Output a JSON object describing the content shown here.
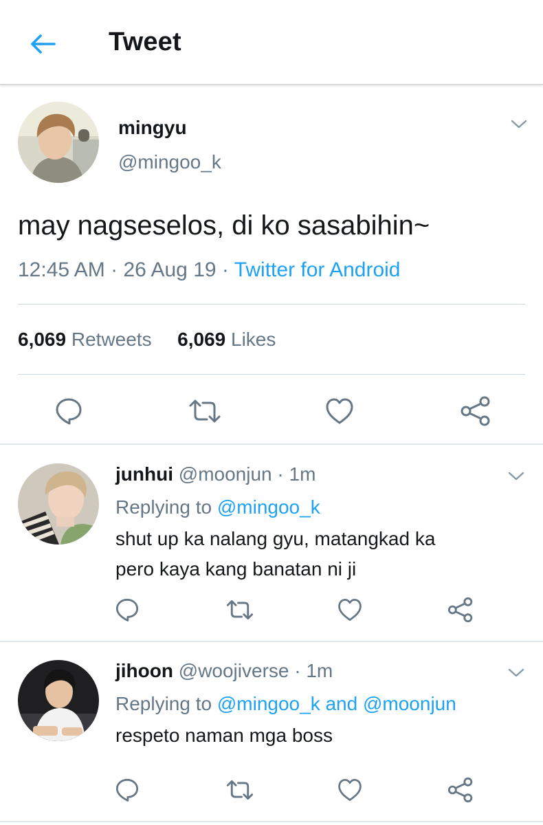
{
  "header": {
    "title": "Tweet"
  },
  "main_tweet": {
    "name": "mingyu",
    "handle": "@mingoo_k",
    "text": "may nagseselos, di ko sasabihin~",
    "time": "12:45 AM",
    "date": "26 Aug 19",
    "source": "Twitter for Android",
    "retweets_count": "6,069",
    "retweets_label": "Retweets",
    "likes_count": "6,069",
    "likes_label": "Likes"
  },
  "replies": [
    {
      "name": "junhui",
      "handle": "@moonjun",
      "time": "1m",
      "replying_prefix": "Replying to",
      "mentions": "@mingoo_k",
      "text_line1": "shut up ka nalang gyu, matangkad ka",
      "text_line2": "pero kaya kang banatan ni ji"
    },
    {
      "name": "jihoon",
      "handle": "@woojiverse",
      "time": "1m",
      "replying_prefix": "Replying to",
      "mentions": "@mingoo_k and @moonjun",
      "text_line1": "respeto naman mga boss"
    }
  ],
  "icons": [
    "back-arrow-icon",
    "chevron-down-icon",
    "reply-icon",
    "retweet-icon",
    "like-icon",
    "share-icon"
  ],
  "colors": {
    "accent": "#1da1f2",
    "muted": "#657786",
    "text": "#14171a",
    "divider": "#e1e8ed"
  }
}
